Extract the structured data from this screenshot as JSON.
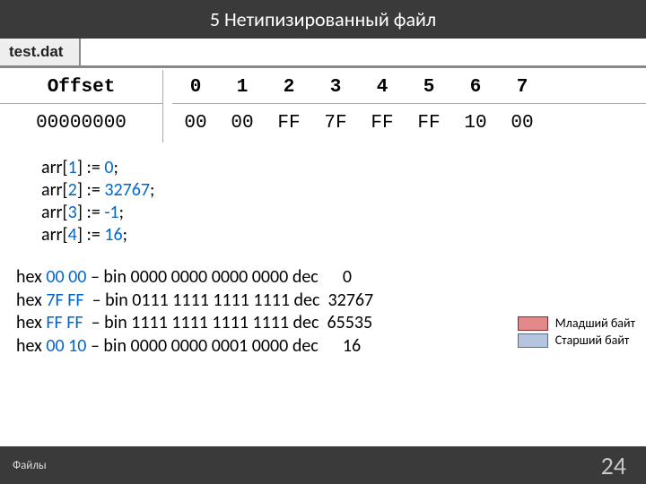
{
  "title": "5 Нетипизированный файл",
  "filename": "test.dat",
  "hex": {
    "offset_label": "Offset",
    "columns": [
      "0",
      "1",
      "2",
      "3",
      "4",
      "5",
      "6",
      "7"
    ],
    "offset_value": "00000000",
    "bytes": [
      "00",
      "00",
      "FF",
      "7F",
      "FF",
      "FF",
      "10",
      "00"
    ]
  },
  "code": {
    "lines": [
      {
        "arr": "arr[",
        "idx": "1",
        "midr": "] := ",
        "val": "0",
        "end": ";"
      },
      {
        "arr": "arr[",
        "idx": "2",
        "midr": "] := ",
        "val": "32767",
        "end": ";"
      },
      {
        "arr": "arr[",
        "idx": "3",
        "midr": "] := ",
        "val": "-1",
        "end": ";"
      },
      {
        "arr": "arr[",
        "idx": "4",
        "midr": "] := ",
        "val": "16",
        "end": ";"
      }
    ]
  },
  "conversions": [
    {
      "p1": "hex ",
      "hx": "00 00",
      "p2": " – bin 0000 0000 0000 0000 dec      0"
    },
    {
      "p1": "hex ",
      "hx": "7F FF",
      "p2": "  – bin 0111 1111 1111 1111 dec  32767"
    },
    {
      "p1": "hex ",
      "hx": "FF FF",
      "p2": "  – bin 1111 1111 1111 1111 dec  65535"
    },
    {
      "p1": "hex ",
      "hx": "00 10",
      "p2": " – bin 0000 0000 0001 0000 dec      16"
    }
  ],
  "legend": {
    "low": "Младший байт",
    "high": "Старший байт"
  },
  "footer": {
    "left": "Файлы",
    "page": "24"
  },
  "chart_data": {
    "type": "table",
    "title": "Hex dump of test.dat with integer interpretations",
    "hex_bytes": [
      "00",
      "00",
      "FF",
      "7F",
      "FF",
      "FF",
      "10",
      "00"
    ],
    "array_assignments": [
      {
        "index": 1,
        "value": 0
      },
      {
        "index": 2,
        "value": 32767
      },
      {
        "index": 3,
        "value": -1
      },
      {
        "index": 4,
        "value": 16
      }
    ],
    "interpretations": [
      {
        "hex": "00 00",
        "bin": "0000 0000 0000 0000",
        "dec": 0
      },
      {
        "hex": "7F FF",
        "bin": "0111 1111 1111 1111",
        "dec": 32767
      },
      {
        "hex": "FF FF",
        "bin": "1111 1111 1111 1111",
        "dec": 65535
      },
      {
        "hex": "00 10",
        "bin": "0000 0000 0001 0000",
        "dec": 16
      }
    ],
    "legend": {
      "red": "Младший байт",
      "blue": "Старший байт"
    }
  }
}
